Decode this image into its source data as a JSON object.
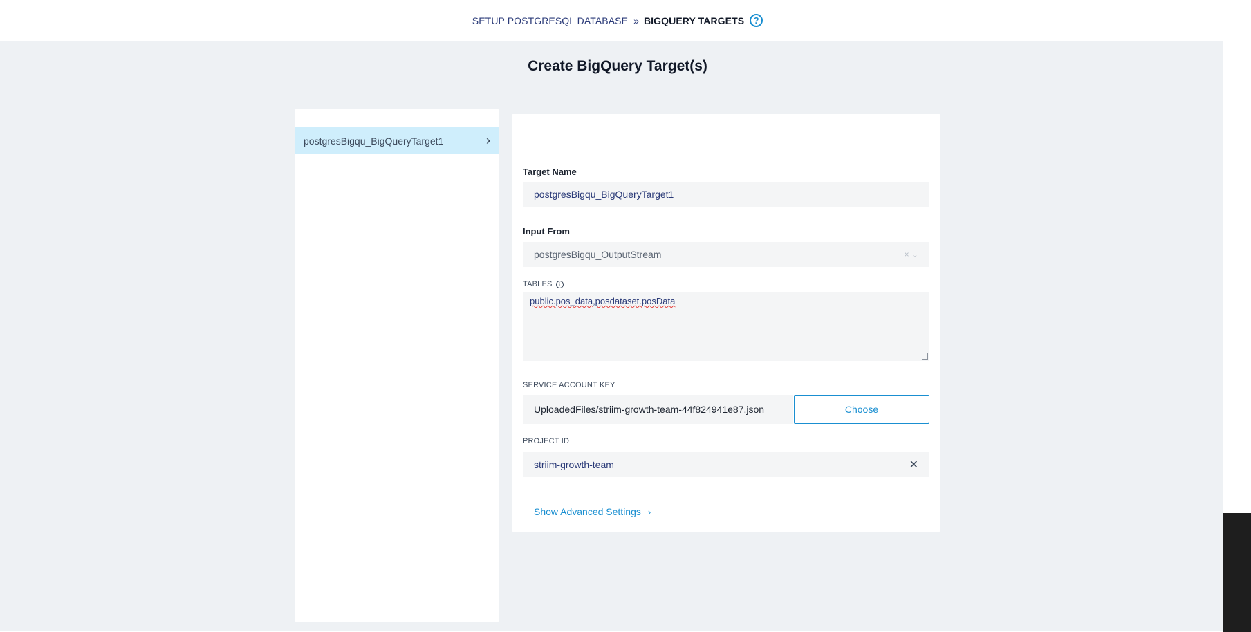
{
  "breadcrumb": {
    "step1": "SETUP POSTGRESQL DATABASE",
    "separator": "»",
    "step2": "BIGQUERY TARGETS",
    "help_icon": "?"
  },
  "page": {
    "title": "Create BigQuery Target(s)"
  },
  "sidebar": {
    "items": [
      {
        "label": "postgresBigqu_BigQueryTarget1",
        "chevron": "›"
      }
    ]
  },
  "form": {
    "target_name_label": "Target Name",
    "target_name_value": "postgresBigqu_BigQueryTarget1",
    "input_from_label": "Input From",
    "input_from_value": "postgresBigqu_OutputStream",
    "input_from_icons": "× ⌄",
    "tables_label": "TABLES",
    "tables_info_icon": "i",
    "tables_value": "public.pos_data,posdataset.posData",
    "service_key_label": "SERVICE ACCOUNT KEY",
    "service_key_value": "UploadedFiles/striim-growth-team-44f824941e87.json",
    "choose_label": "Choose",
    "project_id_label": "PROJECT ID",
    "project_id_value": "striim-growth-team",
    "clear_icon": "✕",
    "advanced_label": "Show Advanced Settings",
    "advanced_chevron": "›"
  },
  "colors": {
    "accent": "#1a8fd1",
    "selected_item": "#cfeefc",
    "background": "#eef1f4",
    "link_dark": "#2a3a78"
  }
}
